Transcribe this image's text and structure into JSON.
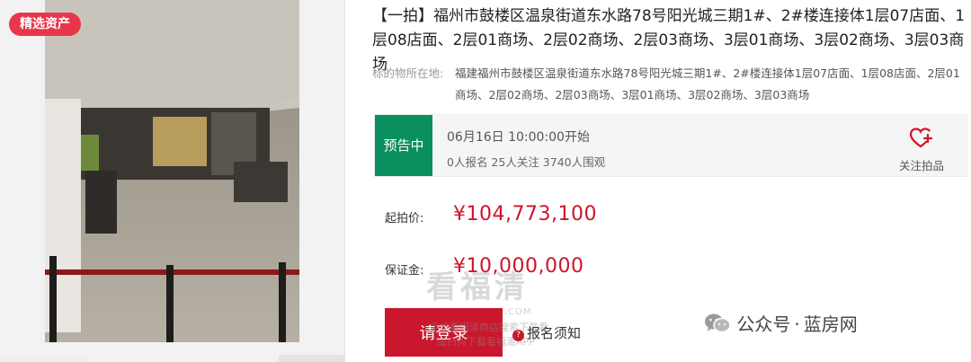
{
  "badge": "精选资产",
  "title": "【一拍】福州市鼓楼区温泉街道东水路78号阳光城三期1#、2#楼连接体1层07店面、1层08店面、2层01商场、2层02商场、2层03商场、3层01商场、3层02商场、3层03商场",
  "location": {
    "label": "标的物所在地:",
    "value": "福建福州市鼓楼区温泉街道东水路78号阳光城三期1#、2#楼连接体1层07店面、1层08店面、2层01商场、2层02商场、2层03商场、3层01商场、3层02商场、3层03商场"
  },
  "status": {
    "tag": "预告中",
    "start_time": "06月16日 10:00:00开始",
    "stats": "0人报名  25人关注  3740人围观",
    "follow_label": "关注拍品",
    "follow_icon": "heart-plus-icon"
  },
  "pricing": {
    "start_label": "起拍价:",
    "start_value": "¥104,773,100",
    "deposit_label": "保证金:",
    "deposit_value": "¥10,000,000"
  },
  "actions": {
    "login_label": "请登录",
    "notice_label": "报名须知"
  },
  "watermark": {
    "name": "看福清",
    "url": "WWW.FQLOOK.COM",
    "line1": "手机看福清商店搜索下载看",
    "line2": "或扫码下载看福清APP"
  },
  "wechat": {
    "icon": "wechat-icon",
    "label_a": "公众号",
    "label_b": "蓝房网"
  },
  "colors": {
    "accent_red": "#c9172d",
    "price_red": "#d0142a",
    "status_green": "#0a8f5e",
    "badge_red": "#e8374b"
  }
}
